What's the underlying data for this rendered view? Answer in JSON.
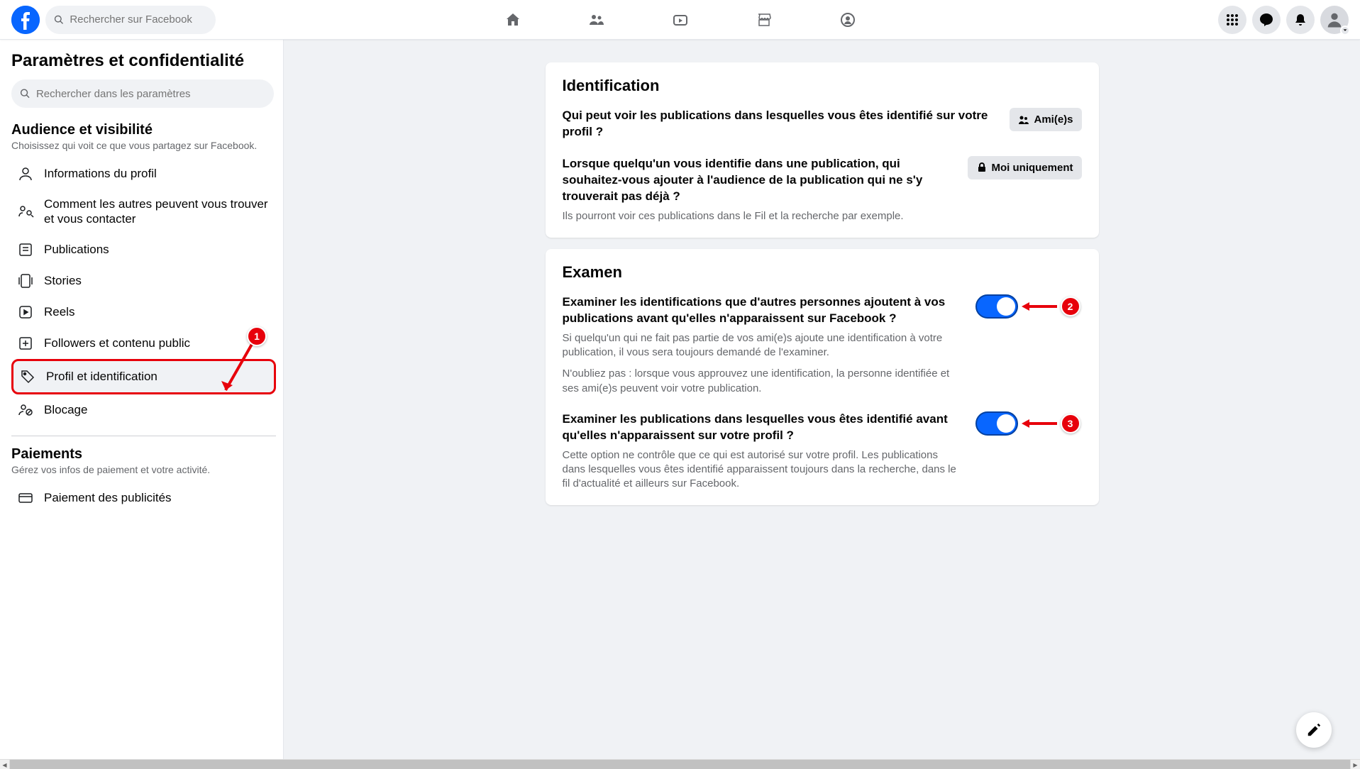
{
  "header": {
    "search_placeholder": "Rechercher sur Facebook"
  },
  "sidebar": {
    "title": "Paramètres et confidentialité",
    "search_placeholder": "Rechercher dans les paramètres",
    "section_audience_title": "Audience et visibilité",
    "section_audience_sub": "Choisissez qui voit ce que vous partagez sur Facebook.",
    "items": {
      "profile_info": "Informations du profil",
      "how_find": "Comment les autres peuvent vous trouver et vous contacter",
      "posts": "Publications",
      "stories": "Stories",
      "reels": "Reels",
      "followers": "Followers et contenu public",
      "profile_tag": "Profil et identification",
      "blocking": "Blocage"
    },
    "section_payments_title": "Paiements",
    "section_payments_sub": "Gérez vos infos de paiement et votre activité.",
    "items2": {
      "ad_payment": "Paiement des publicités"
    }
  },
  "main": {
    "card1": {
      "heading": "Identification",
      "row1_title": "Qui peut voir les publications dans lesquelles vous êtes identifié sur votre profil ?",
      "row1_value": "Ami(e)s",
      "row2_title": "Lorsque quelqu'un vous identifie dans une publication, qui souhaitez-vous ajouter à l'audience de la publication qui ne s'y trouverait pas déjà ?",
      "row2_desc": "Ils pourront voir ces publications dans le Fil et la recherche par exemple.",
      "row2_value": "Moi uniquement"
    },
    "card2": {
      "heading": "Examen",
      "row1_title": "Examiner les identifications que d'autres personnes ajoutent à vos publications avant qu'elles n'apparaissent sur Facebook ?",
      "row1_desc1": "Si quelqu'un qui ne fait pas partie de vos ami(e)s ajoute une identification à votre publication, il vous sera toujours demandé de l'examiner.",
      "row1_desc2": "N'oubliez pas : lorsque vous approuvez une identification, la personne identifiée et ses ami(e)s peuvent voir votre publication.",
      "row2_title": "Examiner les publications dans lesquelles vous êtes identifié avant qu'elles n'apparaissent sur votre profil ?",
      "row2_desc": "Cette option ne contrôle que ce qui est autorisé sur votre profil. Les publications dans lesquelles vous êtes identifié apparaissent toujours dans la recherche, dans le fil d'actualité et ailleurs sur Facebook."
    }
  },
  "annotations": {
    "b1": "1",
    "b2": "2",
    "b3": "3"
  }
}
